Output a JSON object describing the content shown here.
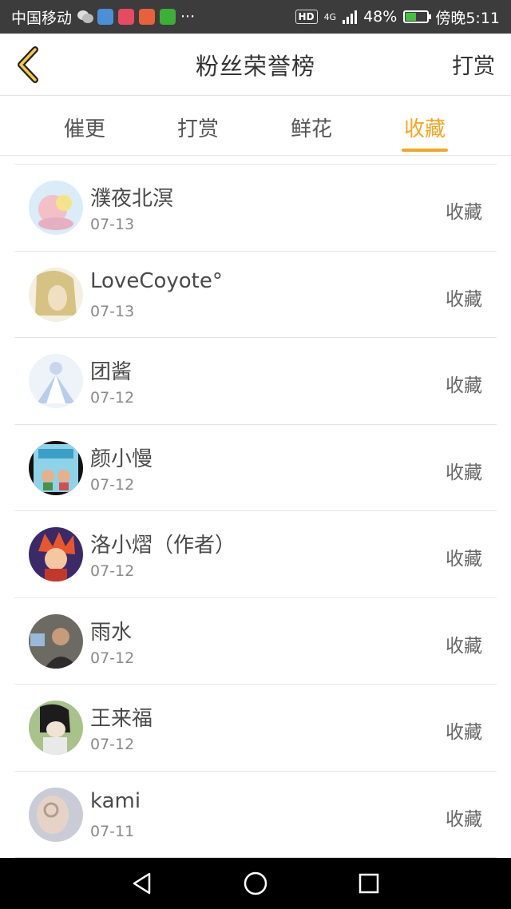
{
  "status_bar": {
    "carrier": "中国移动",
    "more": "···",
    "hd": "HD",
    "network": "4G",
    "battery_pct": "48%",
    "battery_level": 0.48,
    "time": "傍晚5:11"
  },
  "header": {
    "title": "粉丝荣誉榜",
    "right_action": "打赏"
  },
  "tabs": [
    {
      "label": "催更",
      "active": false
    },
    {
      "label": "打赏",
      "active": false
    },
    {
      "label": "鲜花",
      "active": false
    },
    {
      "label": "收藏",
      "active": true
    }
  ],
  "fans": [
    {
      "name": "濮夜北溟",
      "date": "07-13",
      "action": "收藏"
    },
    {
      "name": "LoveCoyote°",
      "date": "07-13",
      "action": "收藏"
    },
    {
      "name": "团酱",
      "date": "07-12",
      "action": "收藏"
    },
    {
      "name": "颜小慢",
      "date": "07-12",
      "action": "收藏"
    },
    {
      "name": "洛小熠（作者）",
      "date": "07-12",
      "action": "收藏"
    },
    {
      "name": "雨水",
      "date": "07-12",
      "action": "收藏"
    },
    {
      "name": "王来福",
      "date": "07-12",
      "action": "收藏"
    },
    {
      "name": "kami",
      "date": "07-11",
      "action": "收藏"
    }
  ],
  "colors": {
    "accent": "#f5a623",
    "status_bar": "#3c3c3c",
    "nav_bar": "#000000"
  }
}
